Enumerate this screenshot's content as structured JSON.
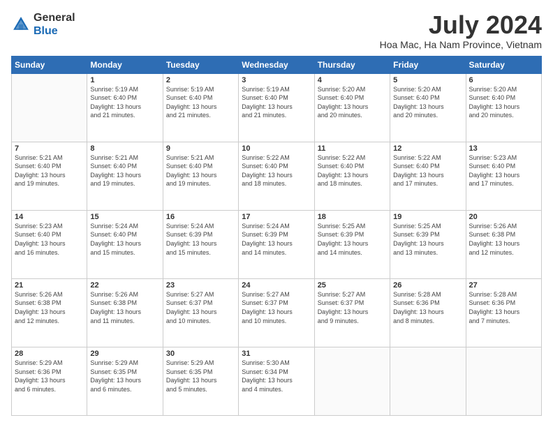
{
  "logo": {
    "general": "General",
    "blue": "Blue"
  },
  "title": {
    "month_year": "July 2024",
    "location": "Hoa Mac, Ha Nam Province, Vietnam"
  },
  "weekdays": [
    "Sunday",
    "Monday",
    "Tuesday",
    "Wednesday",
    "Thursday",
    "Friday",
    "Saturday"
  ],
  "weeks": [
    [
      {
        "day": "",
        "detail": ""
      },
      {
        "day": "1",
        "detail": "Sunrise: 5:19 AM\nSunset: 6:40 PM\nDaylight: 13 hours\nand 21 minutes."
      },
      {
        "day": "2",
        "detail": "Sunrise: 5:19 AM\nSunset: 6:40 PM\nDaylight: 13 hours\nand 21 minutes."
      },
      {
        "day": "3",
        "detail": "Sunrise: 5:19 AM\nSunset: 6:40 PM\nDaylight: 13 hours\nand 21 minutes."
      },
      {
        "day": "4",
        "detail": "Sunrise: 5:20 AM\nSunset: 6:40 PM\nDaylight: 13 hours\nand 20 minutes."
      },
      {
        "day": "5",
        "detail": "Sunrise: 5:20 AM\nSunset: 6:40 PM\nDaylight: 13 hours\nand 20 minutes."
      },
      {
        "day": "6",
        "detail": "Sunrise: 5:20 AM\nSunset: 6:40 PM\nDaylight: 13 hours\nand 20 minutes."
      }
    ],
    [
      {
        "day": "7",
        "detail": "Sunrise: 5:21 AM\nSunset: 6:40 PM\nDaylight: 13 hours\nand 19 minutes."
      },
      {
        "day": "8",
        "detail": "Sunrise: 5:21 AM\nSunset: 6:40 PM\nDaylight: 13 hours\nand 19 minutes."
      },
      {
        "day": "9",
        "detail": "Sunrise: 5:21 AM\nSunset: 6:40 PM\nDaylight: 13 hours\nand 19 minutes."
      },
      {
        "day": "10",
        "detail": "Sunrise: 5:22 AM\nSunset: 6:40 PM\nDaylight: 13 hours\nand 18 minutes."
      },
      {
        "day": "11",
        "detail": "Sunrise: 5:22 AM\nSunset: 6:40 PM\nDaylight: 13 hours\nand 18 minutes."
      },
      {
        "day": "12",
        "detail": "Sunrise: 5:22 AM\nSunset: 6:40 PM\nDaylight: 13 hours\nand 17 minutes."
      },
      {
        "day": "13",
        "detail": "Sunrise: 5:23 AM\nSunset: 6:40 PM\nDaylight: 13 hours\nand 17 minutes."
      }
    ],
    [
      {
        "day": "14",
        "detail": "Sunrise: 5:23 AM\nSunset: 6:40 PM\nDaylight: 13 hours\nand 16 minutes."
      },
      {
        "day": "15",
        "detail": "Sunrise: 5:24 AM\nSunset: 6:40 PM\nDaylight: 13 hours\nand 15 minutes."
      },
      {
        "day": "16",
        "detail": "Sunrise: 5:24 AM\nSunset: 6:39 PM\nDaylight: 13 hours\nand 15 minutes."
      },
      {
        "day": "17",
        "detail": "Sunrise: 5:24 AM\nSunset: 6:39 PM\nDaylight: 13 hours\nand 14 minutes."
      },
      {
        "day": "18",
        "detail": "Sunrise: 5:25 AM\nSunset: 6:39 PM\nDaylight: 13 hours\nand 14 minutes."
      },
      {
        "day": "19",
        "detail": "Sunrise: 5:25 AM\nSunset: 6:39 PM\nDaylight: 13 hours\nand 13 minutes."
      },
      {
        "day": "20",
        "detail": "Sunrise: 5:26 AM\nSunset: 6:38 PM\nDaylight: 13 hours\nand 12 minutes."
      }
    ],
    [
      {
        "day": "21",
        "detail": "Sunrise: 5:26 AM\nSunset: 6:38 PM\nDaylight: 13 hours\nand 12 minutes."
      },
      {
        "day": "22",
        "detail": "Sunrise: 5:26 AM\nSunset: 6:38 PM\nDaylight: 13 hours\nand 11 minutes."
      },
      {
        "day": "23",
        "detail": "Sunrise: 5:27 AM\nSunset: 6:37 PM\nDaylight: 13 hours\nand 10 minutes."
      },
      {
        "day": "24",
        "detail": "Sunrise: 5:27 AM\nSunset: 6:37 PM\nDaylight: 13 hours\nand 10 minutes."
      },
      {
        "day": "25",
        "detail": "Sunrise: 5:27 AM\nSunset: 6:37 PM\nDaylight: 13 hours\nand 9 minutes."
      },
      {
        "day": "26",
        "detail": "Sunrise: 5:28 AM\nSunset: 6:36 PM\nDaylight: 13 hours\nand 8 minutes."
      },
      {
        "day": "27",
        "detail": "Sunrise: 5:28 AM\nSunset: 6:36 PM\nDaylight: 13 hours\nand 7 minutes."
      }
    ],
    [
      {
        "day": "28",
        "detail": "Sunrise: 5:29 AM\nSunset: 6:36 PM\nDaylight: 13 hours\nand 6 minutes."
      },
      {
        "day": "29",
        "detail": "Sunrise: 5:29 AM\nSunset: 6:35 PM\nDaylight: 13 hours\nand 6 minutes."
      },
      {
        "day": "30",
        "detail": "Sunrise: 5:29 AM\nSunset: 6:35 PM\nDaylight: 13 hours\nand 5 minutes."
      },
      {
        "day": "31",
        "detail": "Sunrise: 5:30 AM\nSunset: 6:34 PM\nDaylight: 13 hours\nand 4 minutes."
      },
      {
        "day": "",
        "detail": ""
      },
      {
        "day": "",
        "detail": ""
      },
      {
        "day": "",
        "detail": ""
      }
    ]
  ]
}
